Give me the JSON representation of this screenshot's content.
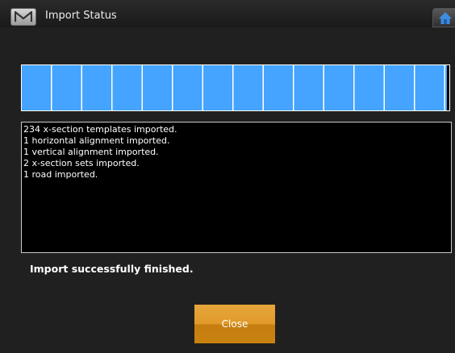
{
  "window": {
    "title": "Import Status",
    "menu_button_icon": "m-logo-icon",
    "home_button_icon": "home-icon"
  },
  "progress": {
    "value_percent": 99.5,
    "fill_color": "#44a4ff"
  },
  "log": {
    "lines": [
      "234 x-section templates imported.",
      "1 horizontal alignment imported.",
      "1 vertical alignment imported.",
      "2 x-section sets imported.",
      "1 road imported."
    ]
  },
  "status": {
    "message": "Import successfully finished."
  },
  "footer": {
    "close_label": "Close",
    "close_color": "#e09a2a"
  }
}
